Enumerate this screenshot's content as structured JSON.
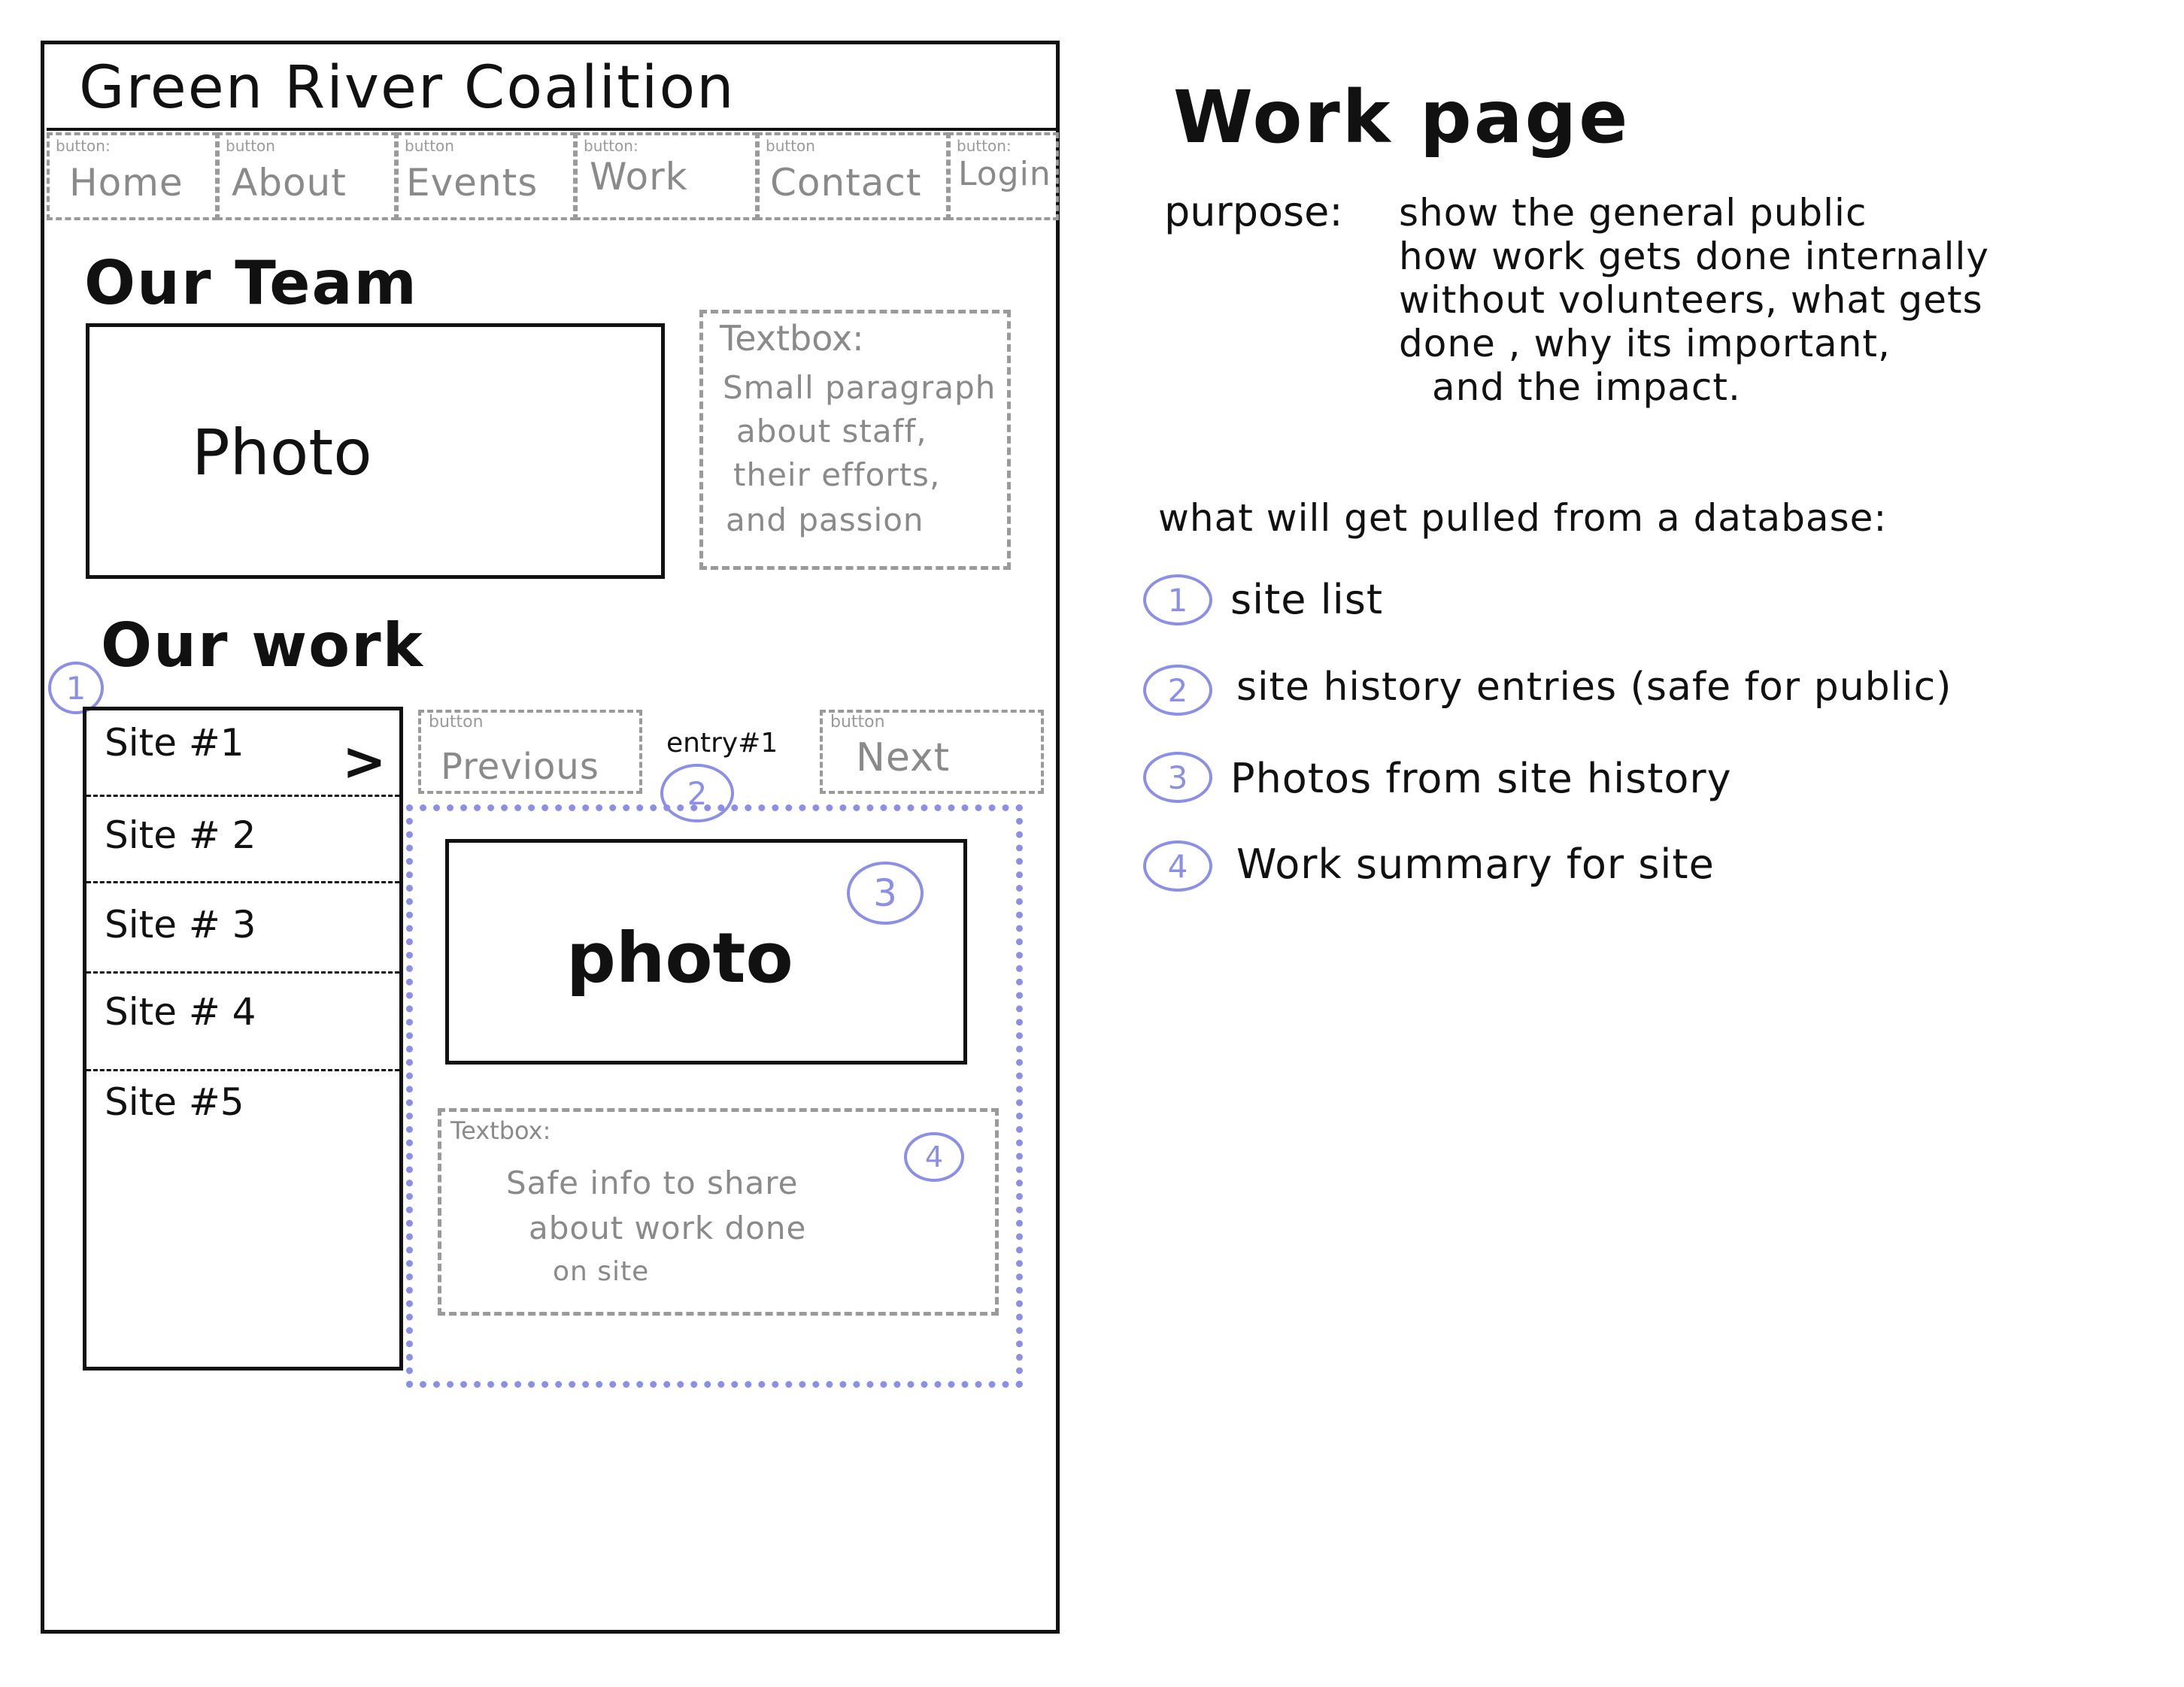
{
  "wireframe": {
    "site_title": "Green River Coalition",
    "nav": [
      {
        "tag": "button:",
        "label": "Home"
      },
      {
        "tag": "button",
        "label": "About"
      },
      {
        "tag": "button",
        "label": "Events"
      },
      {
        "tag": "button:",
        "label": "Work"
      },
      {
        "tag": "button",
        "label": "Contact"
      },
      {
        "tag": "button:",
        "label": "Login"
      }
    ],
    "team": {
      "heading": "Our Team",
      "photo_label": "Photo",
      "textbox": {
        "tag": "Textbox:",
        "lines": [
          "Small paragraph",
          "about staff,",
          "their efforts,",
          "and passion"
        ]
      }
    },
    "work": {
      "heading": "Our work",
      "sites": [
        "Site #1",
        "Site # 2",
        "Site # 3",
        "Site # 4",
        "Site #5"
      ],
      "chevron": ">",
      "prev_button": {
        "tag": "button",
        "label": "Previous"
      },
      "next_button": {
        "tag": "button",
        "label": "Next"
      },
      "entry_label": "entry#1",
      "photo_label": "photo",
      "textbox": {
        "tag": "Textbox:",
        "lines": [
          "Safe info to share",
          "about work done",
          "on site"
        ]
      }
    },
    "markers": [
      "1",
      "2",
      "3",
      "4"
    ]
  },
  "notes": {
    "title": "Work page",
    "purpose_label": "purpose:",
    "purpose_lines": [
      "show the general public",
      "how work gets done internally",
      "without volunteers, what gets",
      "done , why its important,",
      "and the impact."
    ],
    "db_heading": "what will get pulled from a database:",
    "items": [
      {
        "num": "1",
        "text": "site list"
      },
      {
        "num": "2",
        "text": "site history entries (safe for public)"
      },
      {
        "num": "3",
        "text": "Photos from site history"
      },
      {
        "num": "4",
        "text": "Work summary for site"
      }
    ]
  },
  "colors": {
    "ink": "#111111",
    "dashed_gray": "#9a9a9a",
    "annotation_blue": "#8b8fe6"
  }
}
